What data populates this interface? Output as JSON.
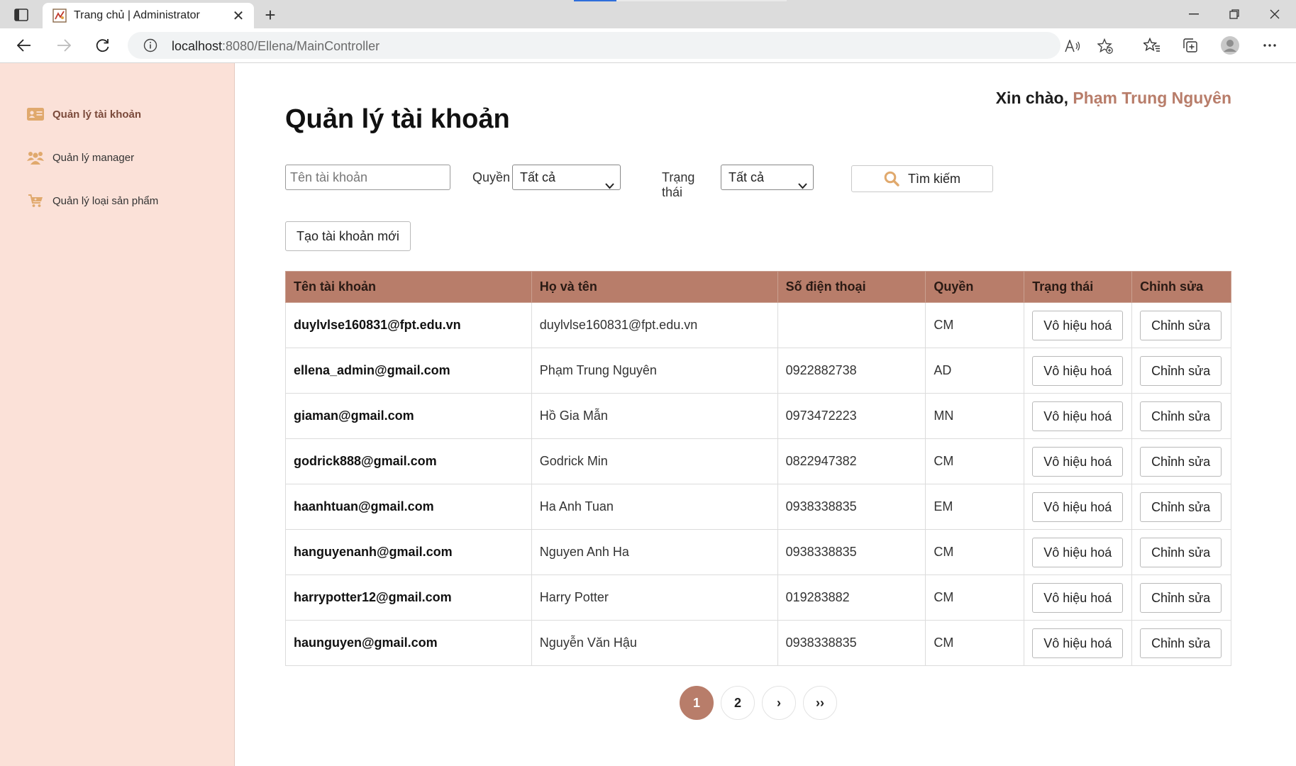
{
  "browser": {
    "tab_title": "Trang chủ | Administrator",
    "url_host": "localhost",
    "url_path": ":8080/Ellena/MainController"
  },
  "sidebar": {
    "items": [
      {
        "label": "Quản lý tài khoản",
        "icon": "id-card-icon",
        "active": true
      },
      {
        "label": "Quản lý manager",
        "icon": "users-icon",
        "active": false
      },
      {
        "label": "Quản lý loại sản phẩm",
        "icon": "cart-icon",
        "active": false
      }
    ]
  },
  "header": {
    "greeting_prefix": "Xin chào,",
    "user_name": "Phạm Trung Nguyên"
  },
  "main": {
    "title": "Quản lý tài khoản",
    "filters": {
      "username_placeholder": "Tên tài khoản",
      "role_label": "Quyền",
      "role_value": "Tất cả",
      "status_label": "Trạng thái",
      "status_value": "Tất cả",
      "search_label": "Tìm kiếm"
    },
    "create_label": "Tạo tài khoản mới",
    "columns": [
      "Tên tài khoản",
      "Họ và tên",
      "Số điện thoại",
      "Quyền",
      "Trạng thái",
      "Chỉnh sửa"
    ],
    "rows": [
      {
        "username": "duylvlse160831@fpt.edu.vn",
        "fullname": "duylvlse160831@fpt.edu.vn",
        "phone": "",
        "role": "CM",
        "status_btn": "Vô hiệu hoá",
        "edit_btn": "Chỉnh sửa"
      },
      {
        "username": "ellena_admin@gmail.com",
        "fullname": "Phạm Trung Nguyên",
        "phone": "0922882738",
        "role": "AD",
        "status_btn": "Vô hiệu hoá",
        "edit_btn": "Chỉnh sửa"
      },
      {
        "username": "giaman@gmail.com",
        "fullname": "Hồ Gia Mẫn",
        "phone": "0973472223",
        "role": "MN",
        "status_btn": "Vô hiệu hoá",
        "edit_btn": "Chỉnh sửa"
      },
      {
        "username": "godrick888@gmail.com",
        "fullname": "Godrick Min",
        "phone": "0822947382",
        "role": "CM",
        "status_btn": "Vô hiệu hoá",
        "edit_btn": "Chỉnh sửa"
      },
      {
        "username": "haanhtuan@gmail.com",
        "fullname": "Ha Anh Tuan",
        "phone": "0938338835",
        "role": "EM",
        "status_btn": "Vô hiệu hoá",
        "edit_btn": "Chỉnh sửa"
      },
      {
        "username": "hanguyenanh@gmail.com",
        "fullname": "Nguyen Anh Ha",
        "phone": "0938338835",
        "role": "CM",
        "status_btn": "Vô hiệu hoá",
        "edit_btn": "Chỉnh sửa"
      },
      {
        "username": "harrypotter12@gmail.com",
        "fullname": "Harry Potter",
        "phone": "019283882",
        "role": "CM",
        "status_btn": "Vô hiệu hoá",
        "edit_btn": "Chỉnh sửa"
      },
      {
        "username": "haunguyen@gmail.com",
        "fullname": "Nguyễn Văn Hậu",
        "phone": "0938338835",
        "role": "CM",
        "status_btn": "Vô hiệu hoá",
        "edit_btn": "Chỉnh sửa"
      }
    ],
    "pagination": {
      "pages": [
        "1",
        "2"
      ],
      "current": "1",
      "next": "›",
      "last": "››"
    }
  },
  "colors": {
    "accent": "#b87d6a",
    "sidebar_bg": "#fbe1d8",
    "search_icon": "#e0a96d"
  }
}
